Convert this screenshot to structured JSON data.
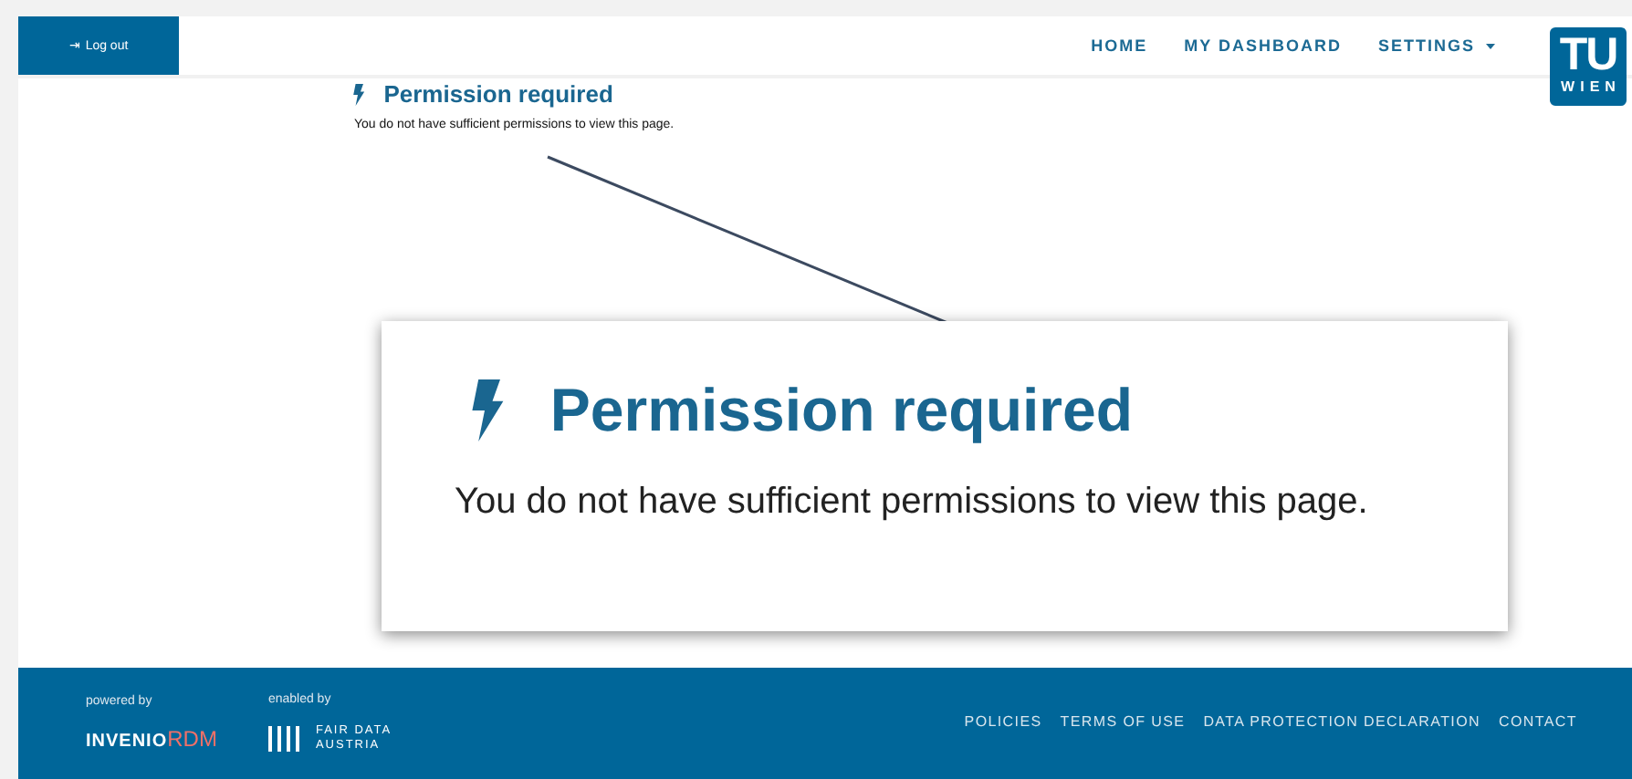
{
  "header": {
    "logout": {
      "icon": "⇥",
      "label": "Log out"
    },
    "nav": [
      {
        "label": "HOME",
        "kind": "link"
      },
      {
        "label": "MY DASHBOARD",
        "kind": "link"
      },
      {
        "label": "SETTINGS",
        "kind": "dropdown"
      }
    ],
    "logo": {
      "top": "TU",
      "bottom": "WIEN"
    }
  },
  "message": {
    "title": "Permission required",
    "text": "You do not have sufficient permissions to view this page."
  },
  "callout": {
    "title": "Permission required",
    "text": "You do not have sufficient permissions to view this page."
  },
  "footer": {
    "powered_by": {
      "caption": "powered by",
      "name": "INVENIO",
      "suffix": "RDM"
    },
    "enabled_by": {
      "caption": "enabled by",
      "line_1": "FAIR DATA",
      "line_2": "AUSTRIA"
    },
    "links": [
      "POLICIES",
      "TERMS OF USE",
      "DATA PROTECTION DECLARATION",
      "CONTACT"
    ]
  }
}
